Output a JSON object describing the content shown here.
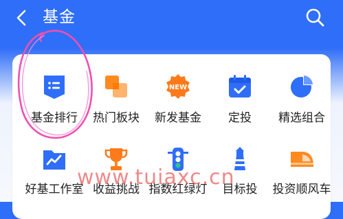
{
  "header": {
    "title": "基金"
  },
  "icons": {
    "back": "chevron-left-icon",
    "search": "search-icon"
  },
  "grid": {
    "row1": [
      {
        "label": "基金排行",
        "icon": "fund-ranking-icon"
      },
      {
        "label": "热门板块",
        "icon": "hot-sector-icon"
      },
      {
        "label": "新发基金",
        "icon": "new-fund-icon",
        "badge": "NEW"
      },
      {
        "label": "定投",
        "icon": "calendar-check-icon"
      },
      {
        "label": "精选组合",
        "icon": "pie-chart-icon"
      }
    ],
    "row2": [
      {
        "label": "好基工作室",
        "icon": "folder-chart-icon"
      },
      {
        "label": "收益挑战",
        "icon": "trophy-icon"
      },
      {
        "label": "指数红绿灯",
        "icon": "traffic-light-icon"
      },
      {
        "label": "目标投",
        "icon": "lighthouse-icon"
      },
      {
        "label": "投资顺风车",
        "icon": "train-icon"
      }
    ]
  },
  "watermark": "www.tuiaxc.cn",
  "colors": {
    "header": "#2f6ef8",
    "iconBlue": "#2f6ef8",
    "iconOrange": "#ff8a1f",
    "circle": "#f04fb0"
  }
}
